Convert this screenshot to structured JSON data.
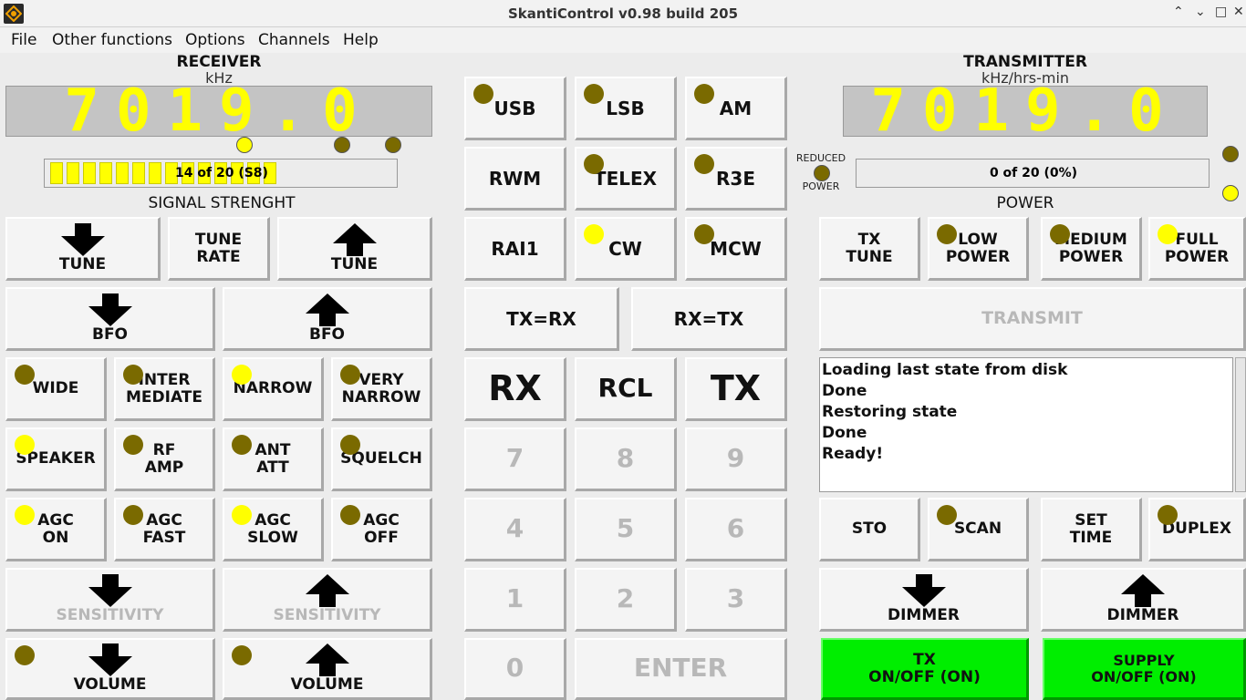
{
  "window": {
    "title": "SkantiControl v0.98 build 205",
    "minimize": "⌃",
    "close": "✕",
    "restore": "⌄",
    "maximize": "□"
  },
  "menu": [
    "File",
    "Other functions",
    "Options",
    "Channels",
    "Help"
  ],
  "receiver": {
    "title": "RECEIVER",
    "unit": "kHz",
    "freq": "7019.0",
    "signal_label": "SIGNAL STRENGHT",
    "signal_text": "14 of 20 (S8)",
    "signal_level": 14,
    "signal_max": 20,
    "tune_down": "TUNE",
    "tune_rate": [
      "TUNE",
      "RATE"
    ],
    "tune_up": "TUNE",
    "bfo_down": "BFO",
    "bfo_up": "BFO",
    "wide": "WIDE",
    "intermediate": [
      "INTER",
      "MEDIATE"
    ],
    "narrow": "NARROW",
    "very_narrow": [
      "VERY",
      "NARROW"
    ],
    "speaker": "SPEAKER",
    "rf_amp": [
      "RF",
      "AMP"
    ],
    "ant_att": [
      "ANT",
      "ATT"
    ],
    "squelch": "SQUELCH",
    "agc_on": [
      "AGC",
      "ON"
    ],
    "agc_fast": [
      "AGC",
      "FAST"
    ],
    "agc_slow": [
      "AGC",
      "SLOW"
    ],
    "agc_off": [
      "AGC",
      "OFF"
    ],
    "sens_down": "SENSITIVITY",
    "sens_up": "SENSITIVITY",
    "vol_down": "VOLUME",
    "vol_up": "VOLUME"
  },
  "modes": {
    "usb": "USB",
    "lsb": "LSB",
    "am": "AM",
    "rwm": "RWM",
    "telex": "TELEX",
    "r3e": "R3E",
    "rai1": "RAI1",
    "cw": "CW",
    "mcw": "MCW",
    "txrx": "TX=RX",
    "rxtx": "RX=TX"
  },
  "keypad": {
    "rx": "RX",
    "rcl": "RCL",
    "tx": "TX",
    "k7": "7",
    "k8": "8",
    "k9": "9",
    "k4": "4",
    "k5": "5",
    "k6": "6",
    "k1": "1",
    "k2": "2",
    "k3": "3",
    "k0": "0",
    "enter": "ENTER"
  },
  "transmitter": {
    "title": "TRANSMITTER",
    "unit": "kHz/hrs-min",
    "freq": "7019.0",
    "reduced_power": [
      "REDUCED",
      "POWER"
    ],
    "power_label": "POWER",
    "power_text": "0 of 20 (0%)",
    "tx_tune": [
      "TX",
      "TUNE"
    ],
    "low_power": [
      "LOW",
      "POWER"
    ],
    "medium_power": [
      "MEDIUM",
      "POWER"
    ],
    "full_power": [
      "FULL",
      "POWER"
    ],
    "transmit": "TRANSMIT",
    "sto": "STO",
    "scan": "SCAN",
    "set_time": [
      "SET",
      "TIME"
    ],
    "duplex": "DUPLEX",
    "dimmer_down": "DIMMER",
    "dimmer_up": "DIMMER",
    "tx_onoff": [
      "TX",
      "ON/OFF (ON)"
    ],
    "supply_onoff": [
      "SUPPLY",
      "ON/OFF (ON)"
    ]
  },
  "log": [
    "Loading last state from disk",
    "Done",
    "Restoring state",
    "Done",
    "Ready!"
  ],
  "colors": {
    "led_on": "#ffff00",
    "led_off": "#7a6a00",
    "green": "#00ee00",
    "lcd_digits": "#ffff00"
  }
}
